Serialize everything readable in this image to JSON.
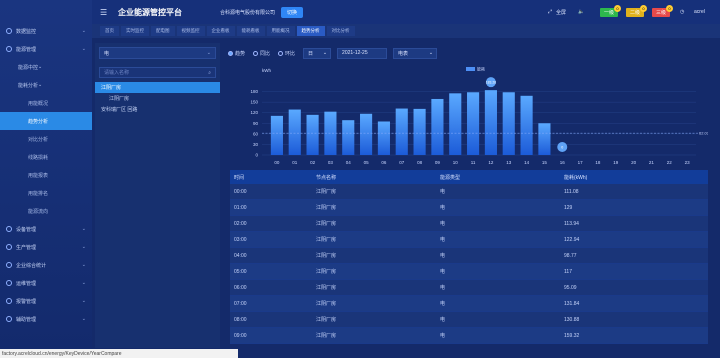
{
  "app": {
    "title": "企业能源管控平台",
    "company": "合科源电气股份有限公司",
    "switch_label": "切换"
  },
  "topbar_right": {
    "fullscreen": "全屏",
    "level1": "一级",
    "level1_count": "0",
    "level2": "二级",
    "level2_count": "0",
    "level3": "三级",
    "level3_count": "0",
    "user": "acrel"
  },
  "tabs": [
    "首页",
    "实时监控",
    "配电图",
    "视频监控",
    "企业看板",
    "能耗看板",
    "用能概况",
    "趋势分析",
    "对比分析"
  ],
  "active_tab": 7,
  "sidebar": {
    "items": [
      {
        "label": "数据监控"
      },
      {
        "label": "能源管理"
      },
      {
        "label": "能源中控",
        "sub": true
      },
      {
        "label": "能耗分析",
        "sub": true
      },
      {
        "label": "用能概况",
        "sub2": true
      },
      {
        "label": "趋势分析",
        "sub2": true,
        "active": true
      },
      {
        "label": "对比分析",
        "sub2": true
      },
      {
        "label": "线路损耗",
        "sub2": true
      },
      {
        "label": "用能报表",
        "sub2": true
      },
      {
        "label": "用能排名",
        "sub2": true
      },
      {
        "label": "能源流向",
        "sub2": true
      },
      {
        "label": "设备管理"
      },
      {
        "label": "生产管理"
      },
      {
        "label": "企业综合统计"
      },
      {
        "label": "运维管理"
      },
      {
        "label": "报警管理"
      },
      {
        "label": "辅助管理"
      }
    ]
  },
  "tree": {
    "energy_type": "电",
    "search_placeholder": "请输入名称",
    "nodes": [
      {
        "label": "江阴厂房",
        "selected": true
      },
      {
        "label": "江阴厂房",
        "selected": false
      },
      {
        "label": "安科瑞厂区 回路",
        "selected": false
      }
    ]
  },
  "filters": {
    "radio_trend": "趋势",
    "radio_yoy": "同比",
    "radio_mom": "环比",
    "period": "日",
    "date": "2021-12-25",
    "level": "电表"
  },
  "chart_data": {
    "type": "bar",
    "ylabel": "kWh",
    "legend": "能耗",
    "ylim": [
      0,
      210
    ],
    "yticks": [
      0,
      30,
      60,
      90,
      120,
      150,
      180
    ],
    "categories": [
      "00",
      "01",
      "02",
      "03",
      "04",
      "05",
      "06",
      "07",
      "08",
      "09",
      "10",
      "11",
      "12",
      "13",
      "14",
      "15",
      "16",
      "17",
      "18",
      "19",
      "20",
      "21",
      "22",
      "23"
    ],
    "values": [
      111.08,
      129,
      113.94,
      122.94,
      98.77,
      117,
      95.09,
      131.84,
      130.88,
      159,
      175,
      178,
      184,
      178,
      168,
      90,
      0,
      0,
      0,
      0,
      0,
      0,
      0,
      0
    ],
    "average_label": "62.03",
    "max_label": "183.26",
    "min_label": "0"
  },
  "table": {
    "headers": [
      "时间",
      "节点名称",
      "能源类型",
      "能耗(kWh)"
    ],
    "rows": [
      [
        "00:00",
        "江阴厂房",
        "电",
        "111.08"
      ],
      [
        "01:00",
        "江阴厂房",
        "电",
        "129"
      ],
      [
        "02:00",
        "江阴厂房",
        "电",
        "113.94"
      ],
      [
        "03:00",
        "江阴厂房",
        "电",
        "122.94"
      ],
      [
        "04:00",
        "江阴厂房",
        "电",
        "98.77"
      ],
      [
        "05:00",
        "江阴厂房",
        "电",
        "117"
      ],
      [
        "06:00",
        "江阴厂房",
        "电",
        "95.09"
      ],
      [
        "07:00",
        "江阴厂房",
        "电",
        "131.84"
      ],
      [
        "08:00",
        "江阴厂房",
        "电",
        "130.88"
      ],
      [
        "09:00",
        "江阴厂房",
        "电",
        "159.32"
      ]
    ]
  },
  "status_url": "factory.acrelcloud.cn/energy/KeyDevice/YearCompare"
}
